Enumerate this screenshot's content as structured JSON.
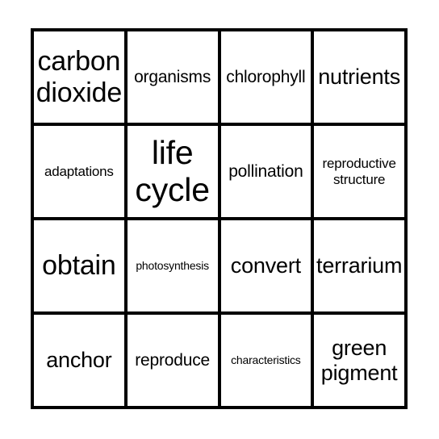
{
  "card": {
    "type": "bingo-card",
    "columns": 4,
    "rows": 4,
    "border_color": "#000000",
    "background_color": "#ffffff",
    "text_color": "#000000",
    "cells": [
      {
        "text": "carbon dioxide",
        "size": "fs-lg"
      },
      {
        "text": "organisms",
        "size": "fs-sm"
      },
      {
        "text": "chlorophyll",
        "size": "fs-sm"
      },
      {
        "text": "nutrients",
        "size": "fs-md"
      },
      {
        "text": "adaptations",
        "size": "fs-xs"
      },
      {
        "text": "life cycle",
        "size": "fs-xl"
      },
      {
        "text": "pollination",
        "size": "fs-sm"
      },
      {
        "text": "reproductive structure",
        "size": "fs-xs"
      },
      {
        "text": "obtain",
        "size": "fs-lg"
      },
      {
        "text": "photosynthesis",
        "size": "fs-xxs"
      },
      {
        "text": "convert",
        "size": "fs-md"
      },
      {
        "text": "terrarium",
        "size": "fs-md"
      },
      {
        "text": "anchor",
        "size": "fs-md"
      },
      {
        "text": "reproduce",
        "size": "fs-sm"
      },
      {
        "text": "characteristics",
        "size": "fs-xxs"
      },
      {
        "text": "green pigment",
        "size": "fs-md"
      }
    ]
  }
}
